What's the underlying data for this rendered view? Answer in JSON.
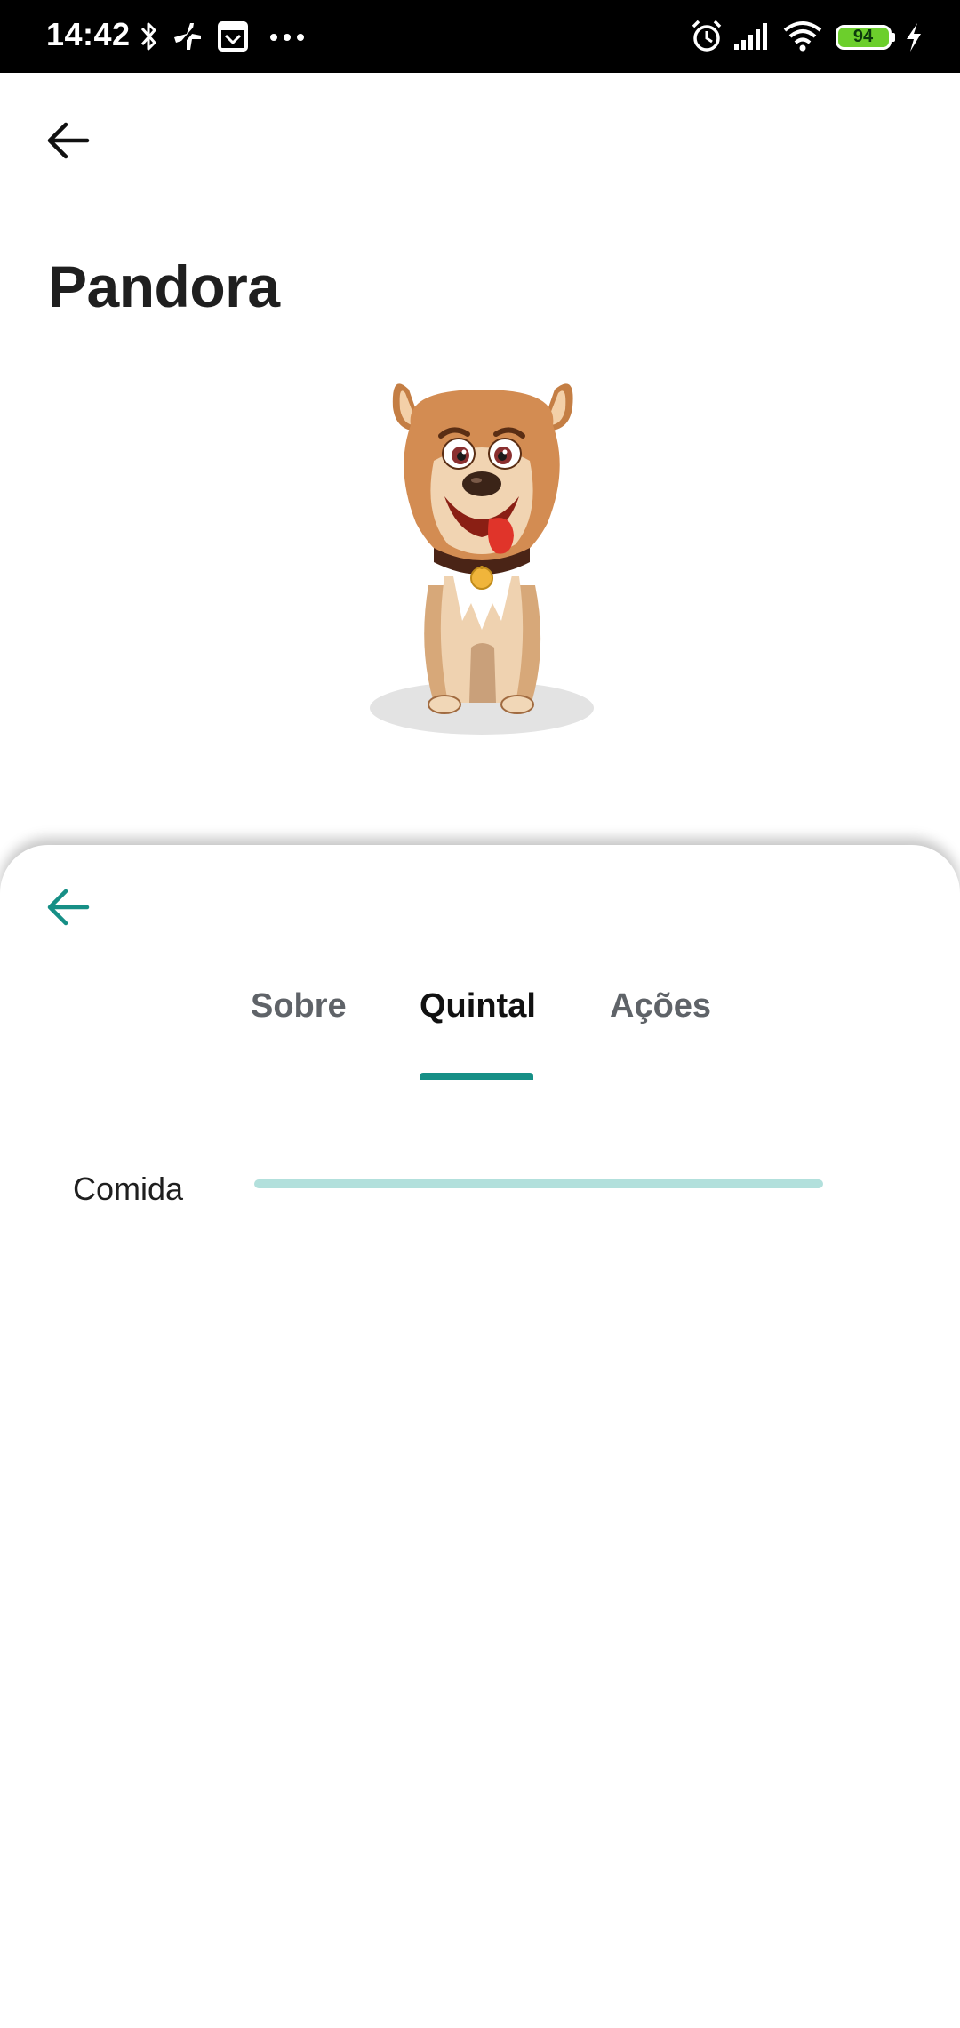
{
  "status_bar": {
    "time": "14:42",
    "battery_level": "94",
    "icons": [
      "bluetooth-icon",
      "airplane-off-icon",
      "calendar-icon",
      "more-dots-icon",
      "alarm-icon",
      "signal-icon",
      "wifi-icon",
      "battery-icon",
      "charging-icon"
    ],
    "battery_color": "#6ccf2c"
  },
  "header": {
    "back_icon": "arrow-left-icon",
    "pet_name": "Pandora"
  },
  "sheet": {
    "back_icon": "arrow-left-icon",
    "accent_color": "#168f86",
    "tabs": [
      {
        "label": "Sobre",
        "active": false
      },
      {
        "label": "Quintal",
        "active": true
      },
      {
        "label": "Ações",
        "active": false
      }
    ],
    "stats": [
      {
        "label": "Comida",
        "progress": 0
      }
    ]
  }
}
